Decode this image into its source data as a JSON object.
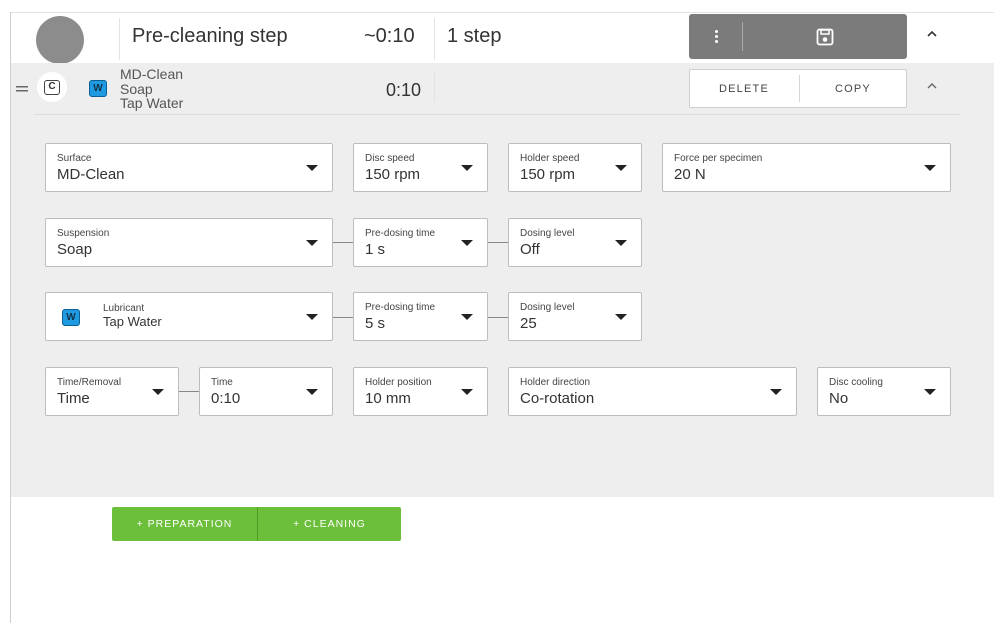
{
  "header": {
    "title": "Pre-cleaning step",
    "duration": "~0:10",
    "step_count": "1 step",
    "more_icon": "vertical-dots-icon",
    "save_icon": "floppy-disk-icon",
    "collapse_icon": "chevron-up-icon"
  },
  "step": {
    "drag_icon": "drag-handle-icon",
    "c_badge": "C",
    "w_badge": "W",
    "surface": "MD-Clean",
    "suspension": "Soap",
    "lubricant": "Tap Water",
    "time": "0:10",
    "delete_label": "DELETE",
    "copy_label": "COPY"
  },
  "fields": {
    "surface": {
      "label": "Surface",
      "value": "MD-Clean"
    },
    "disc_speed": {
      "label": "Disc speed",
      "value": "150 rpm"
    },
    "holder_speed": {
      "label": "Holder speed",
      "value": "150 rpm"
    },
    "force": {
      "label": "Force per specimen",
      "value": "20 N"
    },
    "suspension": {
      "label": "Suspension",
      "value": "Soap"
    },
    "susp_predosing": {
      "label": "Pre-dosing time",
      "value": "1 s"
    },
    "susp_dosing": {
      "label": "Dosing level",
      "value": "Off"
    },
    "lubricant": {
      "label": "Lubricant",
      "value": "Tap Water",
      "badge": "W"
    },
    "lub_predosing": {
      "label": "Pre-dosing time",
      "value": "5 s"
    },
    "lub_dosing": {
      "label": "Dosing level",
      "value": "25"
    },
    "time_removal": {
      "label": "Time/Removal",
      "value": "Time"
    },
    "time": {
      "label": "Time",
      "value": "0:10"
    },
    "holder_position": {
      "label": "Holder position",
      "value": "10 mm"
    },
    "holder_direction": {
      "label": "Holder direction",
      "value": "Co-rotation"
    },
    "disc_cooling": {
      "label": "Disc cooling",
      "value": "No"
    }
  },
  "add_buttons": {
    "preparation": "+ PREPARATION",
    "cleaning": "+ CLEANING"
  },
  "colors": {
    "toolbar": "#7b7b7b",
    "panel": "#eeeeee",
    "accent_green": "#6cbf3b",
    "water_badge": "#1e9be0",
    "avatar": "#8c8c8c"
  }
}
